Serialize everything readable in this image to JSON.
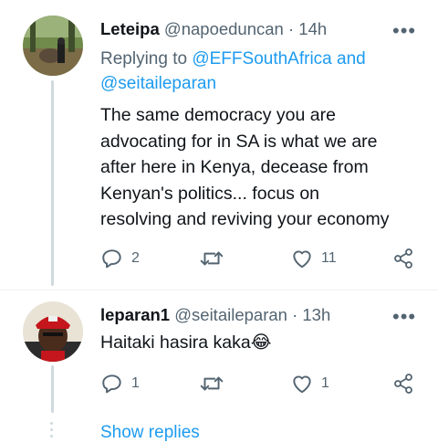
{
  "tweets": [
    {
      "display_name": "Leteipa",
      "handle": "@napoeduncan",
      "sep": " · ",
      "time": "14h",
      "replying_prefix": "Replying to ",
      "replying_to_1": "@EFFSouthAfrica",
      "replying_and": " and",
      "replying_to_2": "@seitaileparan",
      "body_lines": [
        "The same democracy  you are",
        "advocating for in SA is what we are",
        "after here in Kenya, decease from",
        "Kenyan's politics... focus on",
        "resolving and reviving your economy"
      ],
      "replies": "2",
      "retweets": "",
      "likes": "11"
    },
    {
      "display_name": "leparan1",
      "handle": "@seitaileparan",
      "sep": " · ",
      "time": "13h",
      "body": "Haitaki hasira kaka",
      "emoji": "😂",
      "replies": "1",
      "retweets": "",
      "likes": "1"
    }
  ],
  "more_glyph": "•••",
  "show_replies": "Show replies",
  "colors": {
    "accent": "#1d9bf0",
    "muted": "#536471",
    "text": "#0f1419"
  },
  "icons": [
    "avatar",
    "more-icon",
    "reply-icon",
    "retweet-icon",
    "like-icon",
    "share-icon",
    "emoji-icon"
  ]
}
